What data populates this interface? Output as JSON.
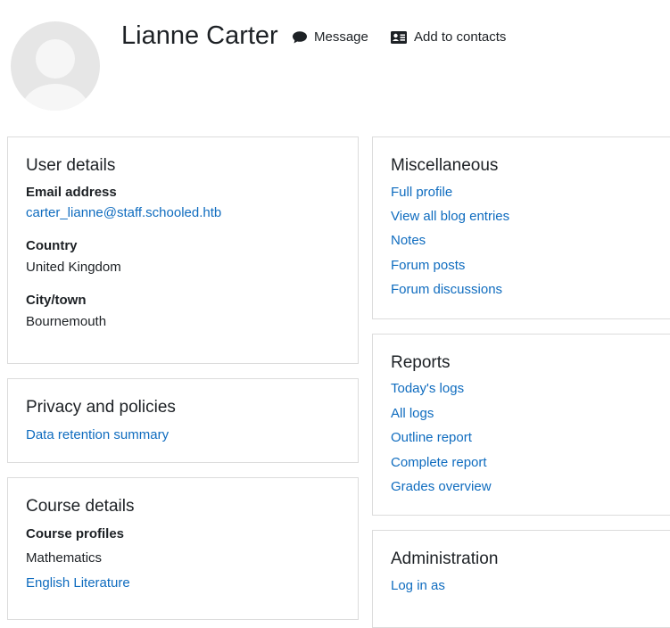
{
  "header": {
    "fullname": "Lianne Carter",
    "message_label": "Message",
    "add_contact_label": "Add to contacts"
  },
  "user_details": {
    "title": "User details",
    "email_label": "Email address",
    "email_value": "carter_lianne@staff.schooled.htb",
    "country_label": "Country",
    "country_value": "United Kingdom",
    "city_label": "City/town",
    "city_value": "Bournemouth"
  },
  "privacy": {
    "title": "Privacy and policies",
    "links": [
      "Data retention summary"
    ]
  },
  "course_details": {
    "title": "Course details",
    "profiles_label": "Course profiles",
    "courses": [
      "Mathematics",
      "English Literature"
    ]
  },
  "miscellaneous": {
    "title": "Miscellaneous",
    "links": [
      "Full profile",
      "View all blog entries",
      "Notes",
      "Forum posts",
      "Forum discussions"
    ]
  },
  "reports": {
    "title": "Reports",
    "links": [
      "Today's logs",
      "All logs",
      "Outline report",
      "Complete report",
      "Grades overview"
    ]
  },
  "administration": {
    "title": "Administration",
    "links": [
      "Log in as"
    ]
  },
  "colors": {
    "link": "#0f6cbf",
    "text": "#1d2125",
    "border": "#dcdcdc",
    "avatar_bg": "#e6e6e6"
  },
  "icons": {
    "message": "speech-bubble-icon",
    "add_contact": "address-card-icon"
  }
}
